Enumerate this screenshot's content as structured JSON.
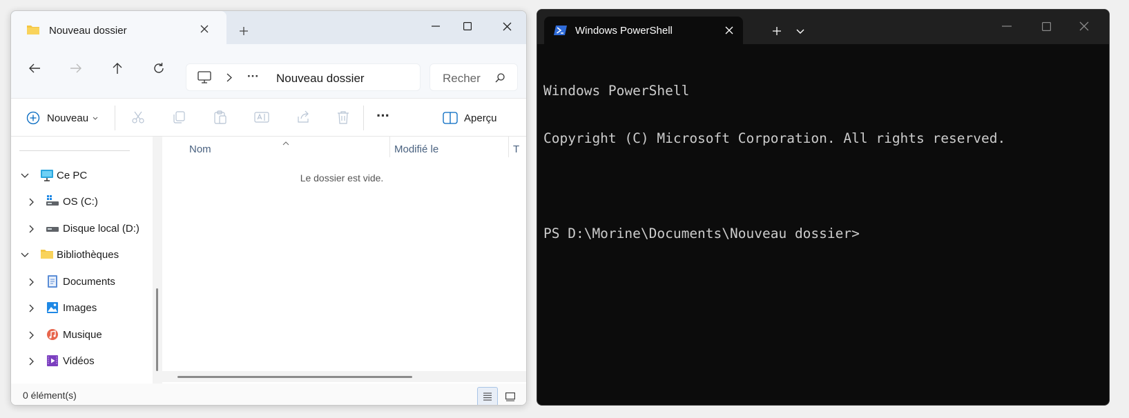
{
  "explorer": {
    "tab_title": "Nouveau dossier",
    "address": {
      "ellipsis": "···",
      "current_folder": "Nouveau dossier"
    },
    "search": {
      "placeholder": "Rechercher",
      "visible_text": "Recher"
    },
    "toolbar": {
      "new_label": "Nouveau",
      "preview_label": "Aperçu",
      "more_label": "···"
    },
    "sidebar": {
      "items": [
        {
          "label": "Ce PC",
          "icon": "pc-icon",
          "expanded": true
        },
        {
          "label": "OS (C:)",
          "icon": "drive-os-icon",
          "expanded": false
        },
        {
          "label": "Disque local (D:)",
          "icon": "drive-icon",
          "expanded": false
        },
        {
          "label": "Bibliothèques",
          "icon": "folder-icon",
          "expanded": true
        },
        {
          "label": "Documents",
          "icon": "documents-icon",
          "expanded": false
        },
        {
          "label": "Images",
          "icon": "images-icon",
          "expanded": false
        },
        {
          "label": "Musique",
          "icon": "music-icon",
          "expanded": false
        },
        {
          "label": "Vidéos",
          "icon": "videos-icon",
          "expanded": false
        }
      ]
    },
    "columns": {
      "name": "Nom",
      "modified": "Modifié le",
      "type_partial": "T"
    },
    "empty_message": "Le dossier est vide.",
    "status": "0 élément(s)"
  },
  "terminal": {
    "tab_title": "Windows PowerShell",
    "lines": [
      "Windows PowerShell",
      "Copyright (C) Microsoft Corporation. All rights reserved.",
      "",
      "PS D:\\Morine\\Documents\\Nouveau dossier>"
    ]
  },
  "colors": {
    "folder": "#f4c542",
    "accent": "#0067c0",
    "terminal_bg": "#0c0c0c",
    "terminal_text": "#cccccc"
  }
}
